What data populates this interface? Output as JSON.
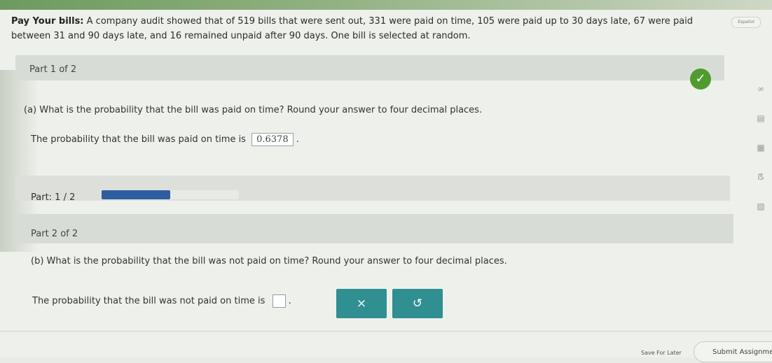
{
  "problem": {
    "title": "Pay Your bills:",
    "text": "A company audit showed that of 519 bills that were sent out, 331 were paid on time, 105 were paid up to 30 days late, 67 were paid between 31 and 90 days late, and 16 remained unpaid after 90 days. One bill is selected at random."
  },
  "badge": "Español",
  "part1": {
    "header": "Part 1 of 2",
    "question": "(a) What is the probability that the bill was paid on time? Round your answer to four decimal places.",
    "answer_prefix": "The probability that the bill was paid on time is",
    "answer_value": "0.6378",
    "answer_suffix": "."
  },
  "progress": {
    "label": "Part: 1 / 2",
    "fraction": 0.5
  },
  "part2": {
    "header": "Part 2 of 2",
    "question": "(b) What is the probability that the bill was not paid on time? Round your answer to four decimal places.",
    "answer_prefix": "The probability that the bill was not paid on time is",
    "answer_suffix": "."
  },
  "buttons": {
    "clear": "×",
    "undo": "↺"
  },
  "icons": [
    "infinity-icon",
    "calculator-icon",
    "calculator-icon",
    "text-icon",
    "book-icon"
  ],
  "icon_glyphs": [
    "∞",
    "▤",
    "▦",
    "ẞ",
    "▧"
  ],
  "footer": {
    "save_later": "Save For Later",
    "submit": "Submit Assignment"
  },
  "colors": {
    "accent": "#2f8f91",
    "check": "#4f9c2d",
    "progress": "#2e5e9e"
  }
}
